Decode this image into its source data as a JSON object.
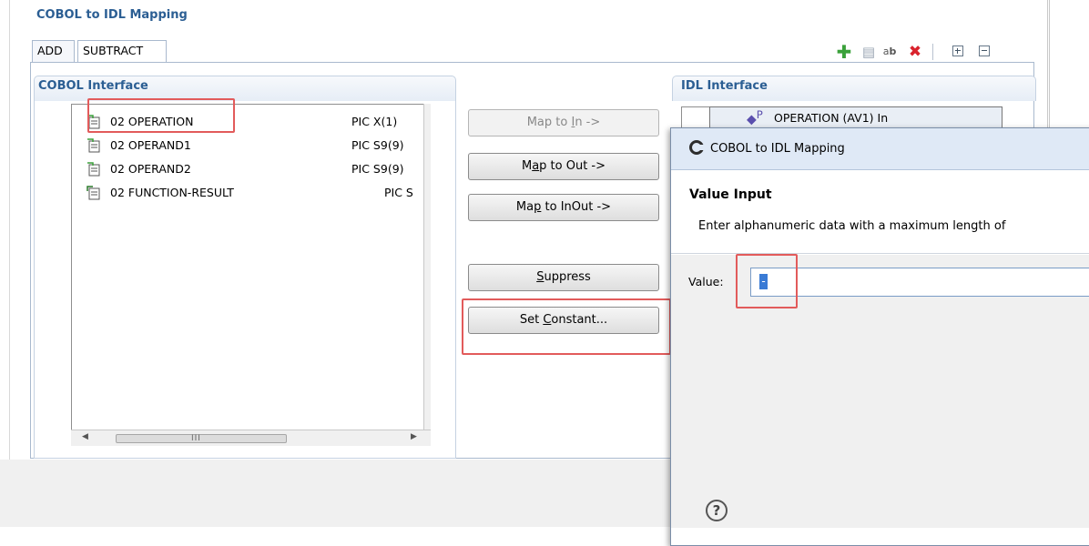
{
  "editor": {
    "title": "COBOL to IDL Mapping",
    "tabs": [
      "ADD",
      "SUBTRACT"
    ],
    "toolbar_icons": [
      "add-icon",
      "copy-icon",
      "rename-icon",
      "delete-icon",
      "expand-all-icon",
      "collapse-all-icon"
    ]
  },
  "cobol_interface": {
    "title": "COBOL Interface",
    "rows": [
      {
        "name": "02 OPERATION",
        "pic": "PIC X(1)",
        "icon": "field-in-icon"
      },
      {
        "name": "02 OPERAND1",
        "pic": "PIC S9(9)",
        "icon": "field-in-icon"
      },
      {
        "name": "02 OPERAND2",
        "pic": "PIC S9(9)",
        "icon": "field-in-icon"
      },
      {
        "name": "02 FUNCTION-RESULT",
        "pic": "PIC S",
        "icon": "field-out-icon"
      }
    ],
    "hscroll_grip": "III"
  },
  "actions": {
    "map_in": {
      "pre": "Map to ",
      "key": "I",
      "post": "n ->"
    },
    "map_out": {
      "pre": "M",
      "key": "a",
      "post": "p to Out ->"
    },
    "map_inout": {
      "pre": "Ma",
      "key": "p",
      "post": " to InOut ->"
    },
    "suppress": {
      "pre": "",
      "key": "S",
      "post": "uppress"
    },
    "set_constant": {
      "pre": "Set ",
      "key": "C",
      "post": "onstant..."
    }
  },
  "idl_interface": {
    "title": "IDL Interface",
    "rows": [
      {
        "name": "OPERATION  (AV1)  In",
        "icon": "parameter-icon",
        "badge": "P"
      }
    ]
  },
  "dialog": {
    "title": "COBOL to IDL Mapping",
    "heading": "Value Input",
    "message": "Enter alphanumeric data with a maximum length of",
    "value_label": "Value:",
    "value": "-",
    "help": "?"
  },
  "colors": {
    "accent_title": "#2b5e93",
    "highlight": "#e25b5b",
    "selection": "#3a7bd5"
  }
}
